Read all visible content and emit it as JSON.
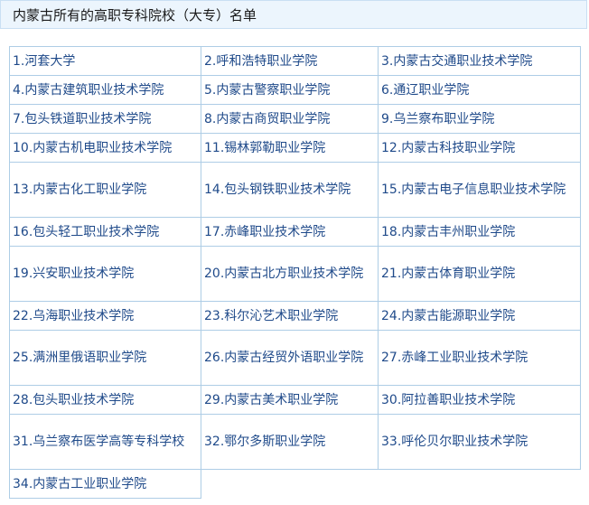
{
  "title": "内蒙古所有的高职专科院校（大专）名单",
  "schools": [
    "1.河套大学",
    "2.呼和浩特职业学院",
    "3.内蒙古交通职业技术学院",
    "4.内蒙古建筑职业技术学院",
    "5.内蒙古警察职业学院",
    "6.通辽职业学院",
    "7.包头铁道职业技术学院",
    "8.内蒙古商贸职业学院",
    "9.乌兰察布职业学院",
    "10.内蒙古机电职业技术学院",
    "11.锡林郭勒职业学院",
    "12.内蒙古科技职业学院",
    "13.内蒙古化工职业学院",
    "14.包头钢铁职业技术学院",
    "15.内蒙古电子信息职业技术学院",
    "16.包头轻工职业技术学院",
    "17.赤峰职业技术学院",
    "18.内蒙古丰州职业学院",
    "19.兴安职业技术学院",
    "20.内蒙古北方职业技术学院",
    "21.内蒙古体育职业学院",
    "22.乌海职业技术学院",
    "23.科尔沁艺术职业学院",
    "24.内蒙古能源职业学院",
    "25.满洲里俄语职业学院",
    "26.内蒙古经贸外语职业学院",
    "27.赤峰工业职业技术学院",
    "28.包头职业技术学院",
    "29.内蒙古美术职业学院",
    "30.阿拉善职业技术学院",
    "31.乌兰察布医学高等专科学校",
    "32.鄂尔多斯职业学院",
    "33.呼伦贝尔职业技术学院",
    "34.内蒙古工业职业学院"
  ]
}
